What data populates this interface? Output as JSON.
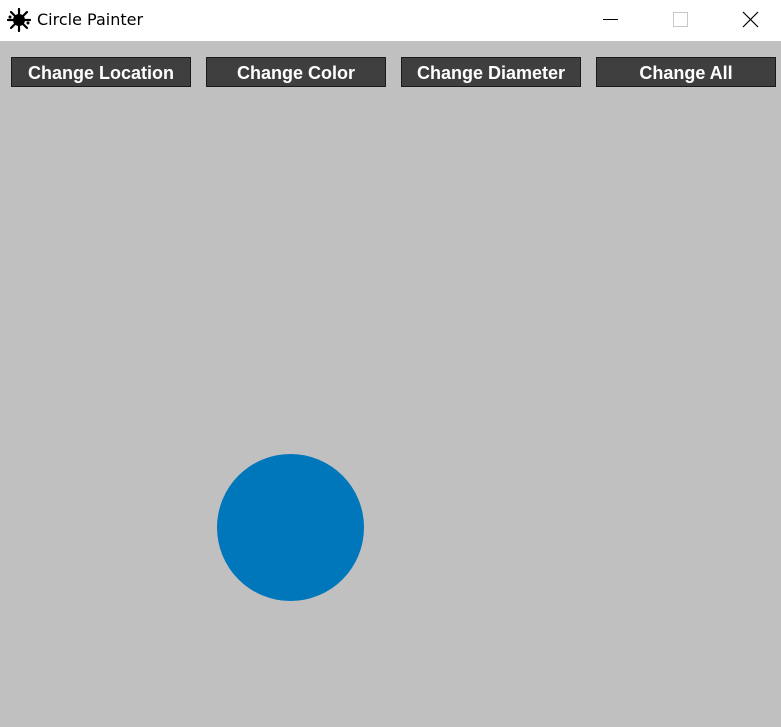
{
  "window": {
    "title": "Circle Painter",
    "app_icon": "paint-splat-icon",
    "controls": {
      "minimize_icon": "minimize-icon",
      "maximize_icon": "maximize-icon",
      "close_icon": "close-icon"
    }
  },
  "toolbar": {
    "change_location_label": "Change Location",
    "change_color_label": "Change Color",
    "change_diameter_label": "Change Diameter",
    "change_all_label": "Change All"
  },
  "canvas": {
    "background_color": "#c0c0c0",
    "circle": {
      "color": "#0076bb"
    }
  },
  "colors": {
    "button_background": "#3f3f3f",
    "button_text": "#ffffff",
    "titlebar_background": "#ffffff"
  }
}
